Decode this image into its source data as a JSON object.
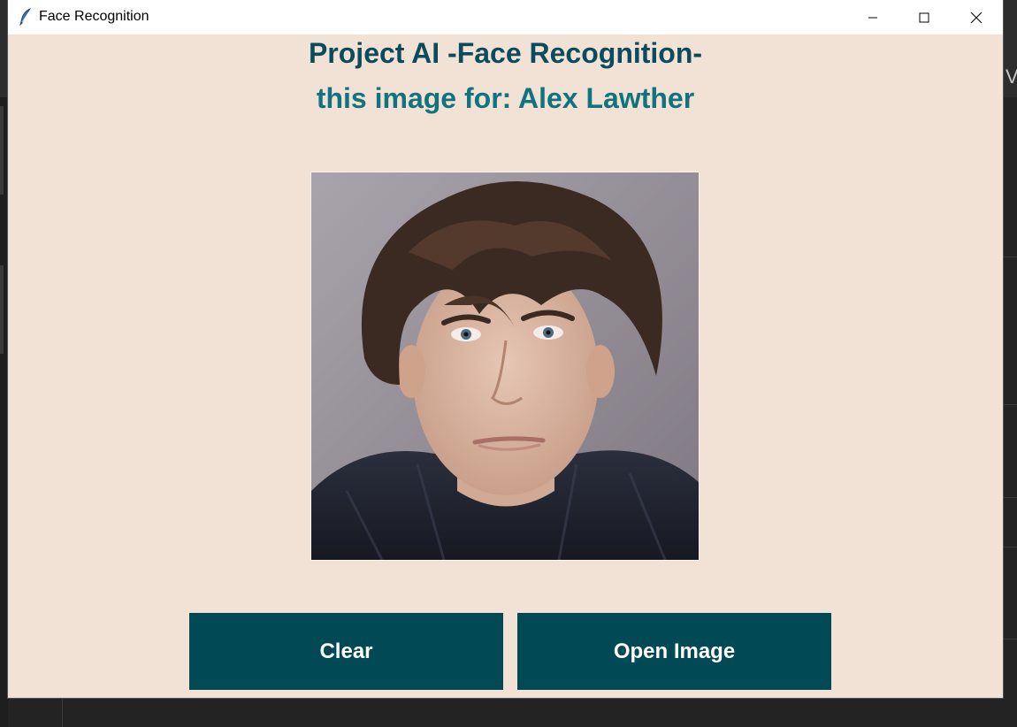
{
  "window": {
    "title": "Face Recognition"
  },
  "main": {
    "heading": "Project AI -Face Recognition-",
    "result": "this image for: Alex Lawther",
    "photo_alt": "face photo"
  },
  "buttons": {
    "clear_label": "Clear",
    "open_label": "Open Image"
  },
  "background": {
    "peek_text": "V"
  },
  "colors": {
    "window_bg": "#f2e2d5",
    "heading": "#0b4b5e",
    "result": "#11737d",
    "button_bg": "#024956",
    "button_text": "#ffffff"
  }
}
